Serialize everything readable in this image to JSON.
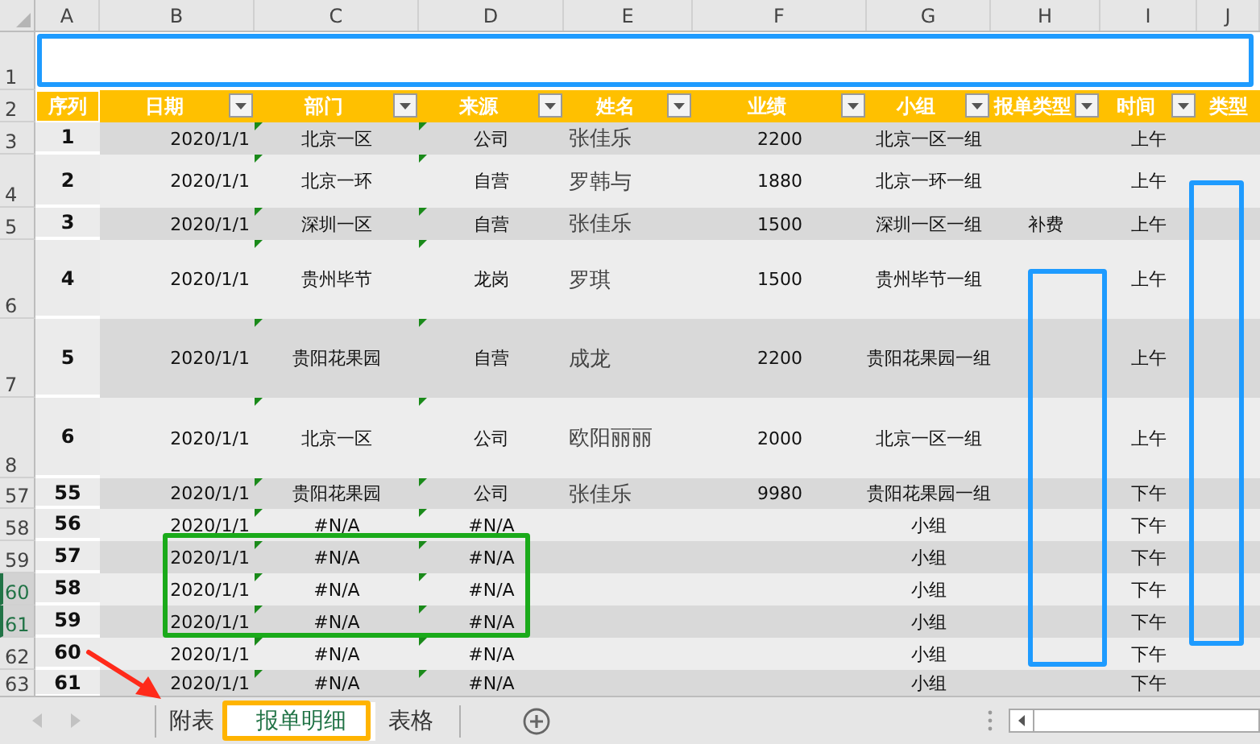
{
  "columns": [
    {
      "letter": "A"
    },
    {
      "letter": "B"
    },
    {
      "letter": "C"
    },
    {
      "letter": "D"
    },
    {
      "letter": "E"
    },
    {
      "letter": "F"
    },
    {
      "letter": "G"
    },
    {
      "letter": "H"
    },
    {
      "letter": "I"
    },
    {
      "letter": "J"
    }
  ],
  "title_row": {
    "row_number": "1"
  },
  "header_row": {
    "row_number": "2",
    "cells": [
      {
        "label": "序列",
        "filter": false
      },
      {
        "label": "日期",
        "filter": true
      },
      {
        "label": "部门",
        "filter": true
      },
      {
        "label": "来源",
        "filter": true
      },
      {
        "label": "姓名",
        "filter": true
      },
      {
        "label": "业绩",
        "filter": true
      },
      {
        "label": "小组",
        "filter": true
      },
      {
        "label": "报单类型",
        "filter": true
      },
      {
        "label": "时间",
        "filter": true
      },
      {
        "label": "类型",
        "filter": false
      }
    ]
  },
  "rows": [
    {
      "row_number": "3",
      "selected": false,
      "warning_marks": true,
      "cells": {
        "A": "1",
        "B": "2020/1/1",
        "C": "北京一区",
        "D": "公司",
        "E": "张佳乐",
        "F": "2200",
        "G": "北京一区一组",
        "I": "上午"
      }
    },
    {
      "row_number": "4",
      "selected": false,
      "warning_marks": true,
      "cells": {
        "A": "2",
        "B": "2020/1/1",
        "C": "北京一环",
        "D": "自营",
        "E": "罗韩与",
        "F": "1880",
        "G": "北京一环一组",
        "I": "上午"
      }
    },
    {
      "row_number": "5",
      "selected": false,
      "warning_marks": true,
      "cells": {
        "A": "3",
        "B": "2020/1/1",
        "C": "深圳一区",
        "D": "自营",
        "E": "张佳乐",
        "F": "1500",
        "G": "深圳一区一组",
        "H": "补费",
        "I": "上午"
      }
    },
    {
      "row_number": "6",
      "selected": false,
      "warning_marks": true,
      "cells": {
        "A": "4",
        "B": "2020/1/1",
        "C": "贵州毕节",
        "D": "龙岗",
        "E": "罗琪",
        "F": "1500",
        "G": "贵州毕节一组",
        "I": "上午"
      }
    },
    {
      "row_number": "7",
      "selected": false,
      "warning_marks": true,
      "cells": {
        "A": "5",
        "B": "2020/1/1",
        "C": "贵阳花果园",
        "D": "自营",
        "E": "成龙",
        "F": "2200",
        "G": "贵阳花果园一组",
        "I": "上午"
      }
    },
    {
      "row_number": "8",
      "selected": false,
      "warning_marks": true,
      "cells": {
        "A": "6",
        "B": "2020/1/1",
        "C": "北京一区",
        "D": "公司",
        "E": "欧阳丽丽",
        "F": "2000",
        "G": "北京一区一组",
        "I": "上午"
      }
    },
    {
      "row_number": "57",
      "selected": false,
      "warning_marks": true,
      "cells": {
        "A": "55",
        "B": "2020/1/1",
        "C": "贵阳花果园",
        "D": "公司",
        "E": "张佳乐",
        "F": "9980",
        "G": "贵阳花果园一组",
        "I": "下午"
      }
    },
    {
      "row_number": "58",
      "selected": false,
      "warning_marks": true,
      "cells": {
        "A": "56",
        "B": "2020/1/1",
        "C": "#N/A",
        "D": "#N/A",
        "G": "小组",
        "I": "下午"
      }
    },
    {
      "row_number": "59",
      "selected": false,
      "warning_marks": true,
      "cells": {
        "A": "57",
        "B": "2020/1/1",
        "C": "#N/A",
        "D": "#N/A",
        "G": "小组",
        "I": "下午"
      }
    },
    {
      "row_number": "60",
      "selected": true,
      "warning_marks": true,
      "cells": {
        "A": "58",
        "B": "2020/1/1",
        "C": "#N/A",
        "D": "#N/A",
        "G": "小组",
        "I": "下午"
      }
    },
    {
      "row_number": "61",
      "selected": true,
      "warning_marks": true,
      "cells": {
        "A": "59",
        "B": "2020/1/1",
        "C": "#N/A",
        "D": "#N/A",
        "G": "小组",
        "I": "下午"
      }
    },
    {
      "row_number": "62",
      "selected": false,
      "warning_marks": true,
      "cells": {
        "A": "60",
        "B": "2020/1/1",
        "C": "#N/A",
        "D": "#N/A",
        "G": "小组",
        "I": "下午"
      }
    },
    {
      "row_number": "63",
      "selected": false,
      "warning_marks": true,
      "cells": {
        "A": "61",
        "B": "2020/1/1",
        "C": "#N/A",
        "D": "#N/A",
        "G": "小组",
        "I": "下午"
      }
    }
  ],
  "sheet_tabs": [
    {
      "label": "附表",
      "selected": false
    },
    {
      "label": "报单明细",
      "selected": true
    },
    {
      "label": "表格",
      "selected": false
    }
  ],
  "annotations": [
    {
      "kind": "box",
      "color": "#1e9bff"
    },
    {
      "kind": "box",
      "color": "#1e9bff"
    },
    {
      "kind": "box",
      "color": "#1e9bff"
    },
    {
      "kind": "box",
      "color": "#1aaa1a"
    },
    {
      "kind": "box",
      "color": "#ffb400"
    },
    {
      "kind": "arrow",
      "color": "#ff2a1a"
    }
  ]
}
